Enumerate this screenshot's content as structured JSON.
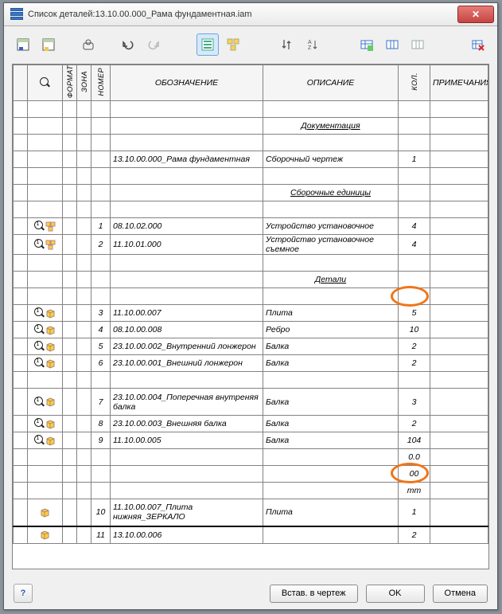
{
  "window": {
    "title": "Список деталей:13.10.00.000_Рама фундаментная.iam"
  },
  "cols": {
    "c1": "",
    "c2": "",
    "c3": "ФОРМАТ",
    "c4": "ЗОНА",
    "c5": "НОМЕР",
    "c6": "ОБОЗНАЧЕНИЕ",
    "c7": "ОПИСАНИЕ",
    "c8": "КОЛ.",
    "c9": "ПРИМЕЧАНИЯ"
  },
  "section": {
    "doc": "Документация",
    "asm": "Сборочные единицы",
    "det": "Детали"
  },
  "rows": {
    "r0": {
      "des": "13.10.00.000_Рама фундаментная",
      "desc": "Сборочный чертеж",
      "qty": "1"
    },
    "r1": {
      "num": "1",
      "des": "08.10.02.000",
      "desc": "Устройство установочное",
      "qty": "4"
    },
    "r2": {
      "num": "2",
      "des": "11.10.01.000",
      "desc": "Устройство установочное съемное",
      "qty": "4"
    },
    "r3": {
      "num": "3",
      "des": "11.10.00.007",
      "desc": "Плита",
      "qty": "5"
    },
    "r4": {
      "num": "4",
      "des": "08.10.00.008",
      "desc": "Ребро",
      "qty": "10"
    },
    "r5": {
      "num": "5",
      "des": "23.10.00.002_Внутренний лонжерон",
      "desc": "Балка",
      "qty": "2"
    },
    "r6": {
      "num": "6",
      "des": "23.10.00.001_Внешний лонжерон",
      "desc": "Балка",
      "qty": "2"
    },
    "r7": {
      "num": "7",
      "des": "23.10.00.004_Поперечная внутреняя балка",
      "desc": "Балка",
      "qty": "3"
    },
    "r8": {
      "num": "8",
      "des": "23.10.00.003_Внешняя балка",
      "desc": "Балка",
      "qty": "2"
    },
    "r9": {
      "num": "9",
      "des": "11.10.00.005",
      "desc": "Балка",
      "qty": "104"
    },
    "r9b": {
      "qty": "0.0"
    },
    "r9c": {
      "qty": "00"
    },
    "r9d": {
      "qty": "mm"
    },
    "r10": {
      "num": "10",
      "des": "11.10.00.007_Плита нижняя_ЗЕРКАЛО",
      "desc": "Плита",
      "qty": "1"
    },
    "r11": {
      "num": "11",
      "des": "13.10.00.006",
      "qty": "2"
    }
  },
  "footer": {
    "insert": "Встав. в чертеж",
    "ok": "OK",
    "cancel": "Отмена"
  }
}
